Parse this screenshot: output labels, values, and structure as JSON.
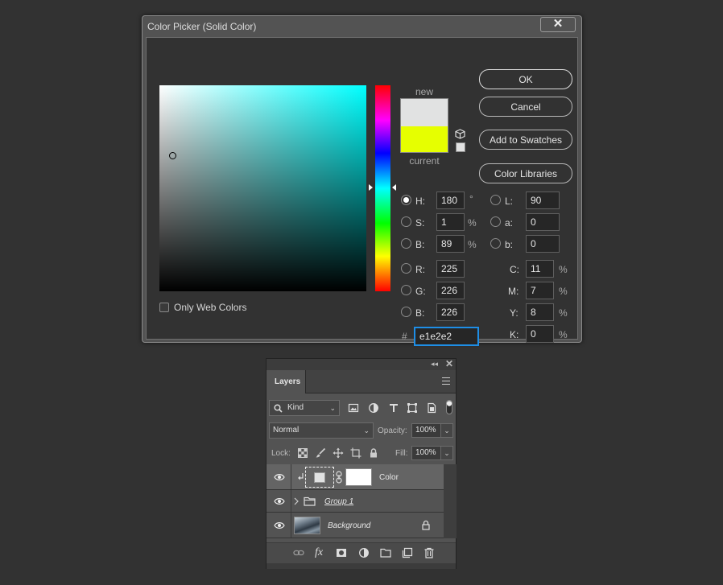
{
  "dialog": {
    "title": "Color Picker (Solid Color)",
    "close_glyph": "✕",
    "only_web_colors_label": "Only Web Colors",
    "only_web_colors_checked": false,
    "swatch_new_label": "new",
    "swatch_current_label": "current",
    "new_color": "#e1e2e2",
    "current_color": "#e6ff00",
    "buttons": {
      "ok": "OK",
      "cancel": "Cancel",
      "add_to_swatches": "Add to Swatches",
      "color_libraries": "Color Libraries"
    },
    "fields": {
      "h": {
        "label": "H:",
        "value": "180",
        "unit": "°",
        "selected": true
      },
      "s": {
        "label": "S:",
        "value": "1",
        "unit": "%"
      },
      "b": {
        "label": "B:",
        "value": "89",
        "unit": "%"
      },
      "r": {
        "label": "R:",
        "value": "225"
      },
      "g": {
        "label": "G:",
        "value": "226"
      },
      "bl": {
        "label": "B:",
        "value": "226"
      },
      "l": {
        "label": "L:",
        "value": "90"
      },
      "a": {
        "label": "a:",
        "value": "0"
      },
      "lab_b": {
        "label": "b:",
        "value": "0"
      },
      "c": {
        "label": "C:",
        "value": "11",
        "unit": "%"
      },
      "m": {
        "label": "M:",
        "value": "7",
        "unit": "%"
      },
      "y": {
        "label": "Y:",
        "value": "8",
        "unit": "%"
      },
      "k": {
        "label": "K:",
        "value": "0",
        "unit": "%"
      }
    },
    "hex": {
      "label": "#",
      "value": "e1e2e2"
    }
  },
  "layers_panel": {
    "collapse_glyph": "◂◂",
    "close_glyph": "✕",
    "tab_label": "Layers",
    "filter_kind": "Kind",
    "blend_mode": "Normal",
    "opacity_label": "Opacity:",
    "opacity_value": "100%",
    "lock_label": "Lock:",
    "fill_label": "Fill:",
    "fill_value": "100%",
    "layers": [
      {
        "name": "Color",
        "selected": true
      },
      {
        "name": "Group 1"
      },
      {
        "name": "Background",
        "locked": true
      }
    ],
    "icons": {
      "filter": [
        "image-filter-icon",
        "adjustment-filter-icon",
        "type-filter-icon",
        "shape-filter-icon",
        "smart-object-filter-icon",
        "filter-toggle-icon"
      ],
      "lock": [
        "lock-transparent-pixels-icon",
        "lock-image-pixels-icon",
        "lock-position-icon",
        "lock-artboard-icon",
        "lock-all-icon"
      ],
      "bottom": [
        "link-layers-icon",
        "fx-icon",
        "add-mask-icon",
        "new-adjustment-icon",
        "new-group-icon",
        "new-layer-icon",
        "delete-layer-icon"
      ]
    }
  }
}
